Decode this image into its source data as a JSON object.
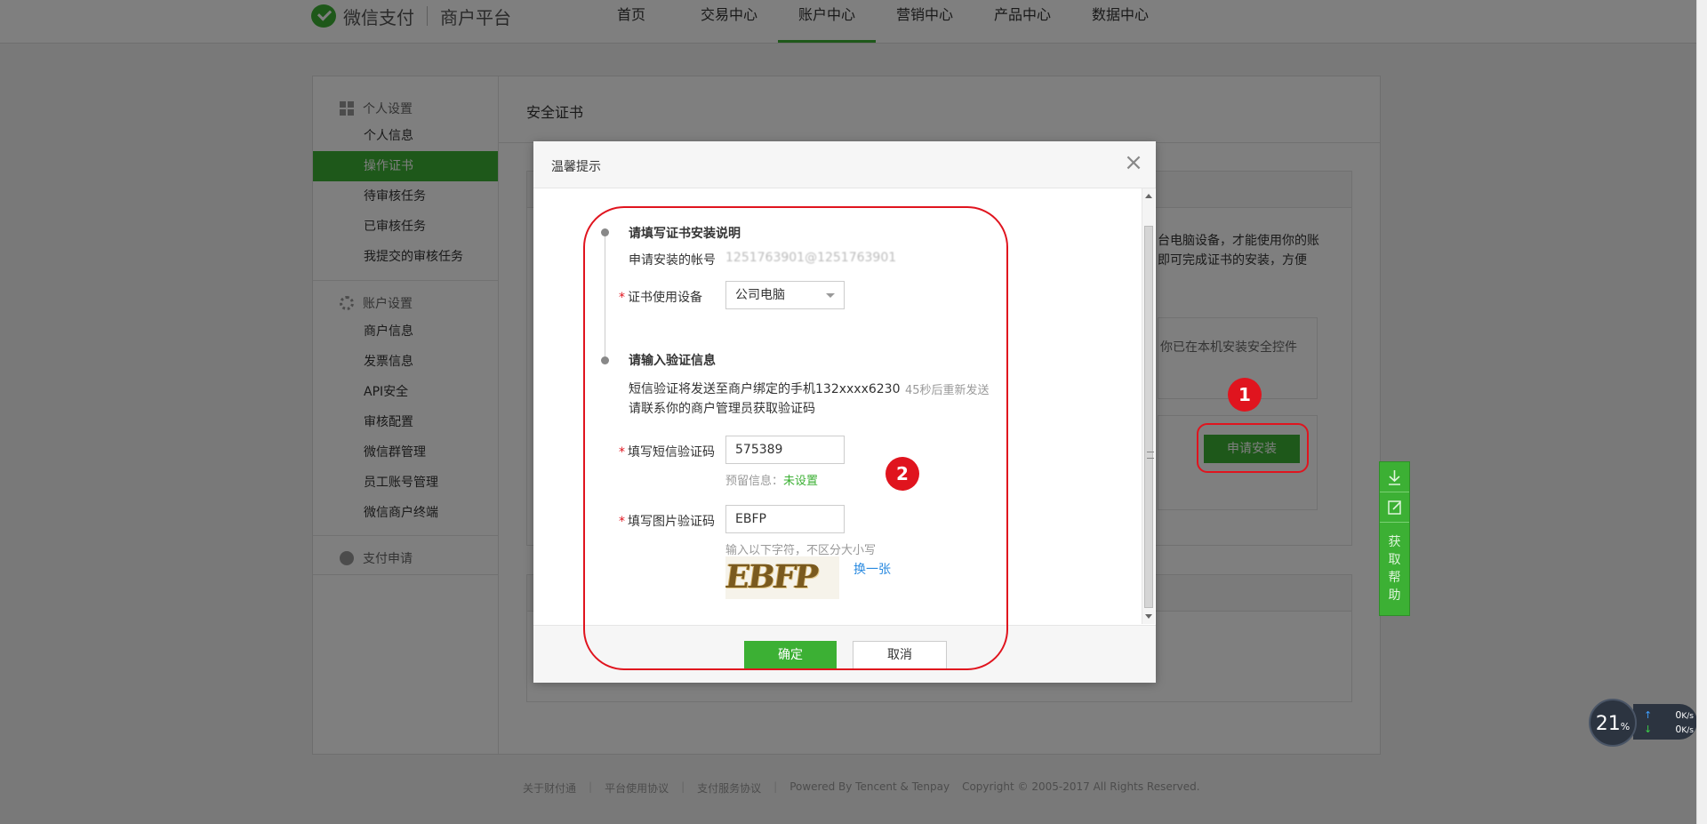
{
  "header": {
    "brand": "微信支付",
    "brand_sub": "商户平台",
    "nav": [
      {
        "label": "首页"
      },
      {
        "label": "交易中心"
      },
      {
        "label": "账户中心"
      },
      {
        "label": "营销中心"
      },
      {
        "label": "产品中心"
      },
      {
        "label": "数据中心"
      }
    ],
    "active_nav": "账户中心"
  },
  "sidebar": {
    "personal_group": "个人设置",
    "personal_items": [
      "个人信息",
      "操作证书",
      "待审核任务",
      "已审核任务",
      "我提交的审核任务"
    ],
    "active_item": "操作证书",
    "account_group": "账户设置",
    "account_items": [
      "商户信息",
      "发票信息",
      "API安全",
      "审核配置",
      "微信群管理",
      "员工账号管理",
      "微信商户终端"
    ],
    "payment_group": "支付申请"
  },
  "content": {
    "title": "安全证书",
    "desc_line1": "台电脑设备，才能使用你的账",
    "desc_line2": "即可完成证书的安装，方便",
    "inner_text": "你已在本机安装安全控件",
    "apply_button": "申请安装",
    "badge1": "1",
    "badge2": "2"
  },
  "modal": {
    "title": "温馨提示",
    "close": "×",
    "step1_title": "请填写证书安装说明",
    "account_label": "申请安装的帐号",
    "account_value": "1251763901@1251763901",
    "device_label": "证书使用设备",
    "device_value": "公司电脑",
    "step2_title": "请输入验证信息",
    "sms_notice": "短信验证将发送至商户绑定的手机132xxxx6230",
    "resend": "45秒后重新发送",
    "contact_notice": "请联系你的商户管理员获取验证码",
    "sms_label": "填写短信验证码",
    "sms_value": "575389",
    "reserve_label": "预留信息：",
    "reserve_value": "未设置",
    "img_label": "填写图片验证码",
    "img_value": "EBFP",
    "img_hint": "输入以下字符，不区分大小写",
    "captcha_text": "EBFP",
    "refresh": "换一张",
    "ok": "确定",
    "cancel": "取消"
  },
  "help": {
    "label": "获取帮助"
  },
  "network": {
    "percent": "21",
    "percent_unit": "%",
    "up": "0",
    "down": "0",
    "unit": "K/s"
  },
  "footer": {
    "links": [
      "关于财付通",
      "平台使用协议",
      "支付服务协议"
    ],
    "powered": "Powered By Tencent & Tenpay",
    "copyright": "Copyright © 2005-2017 All Rights Reserved."
  },
  "colors": {
    "brand_green": "#3cb034",
    "annotation_red": "#e0141e"
  }
}
